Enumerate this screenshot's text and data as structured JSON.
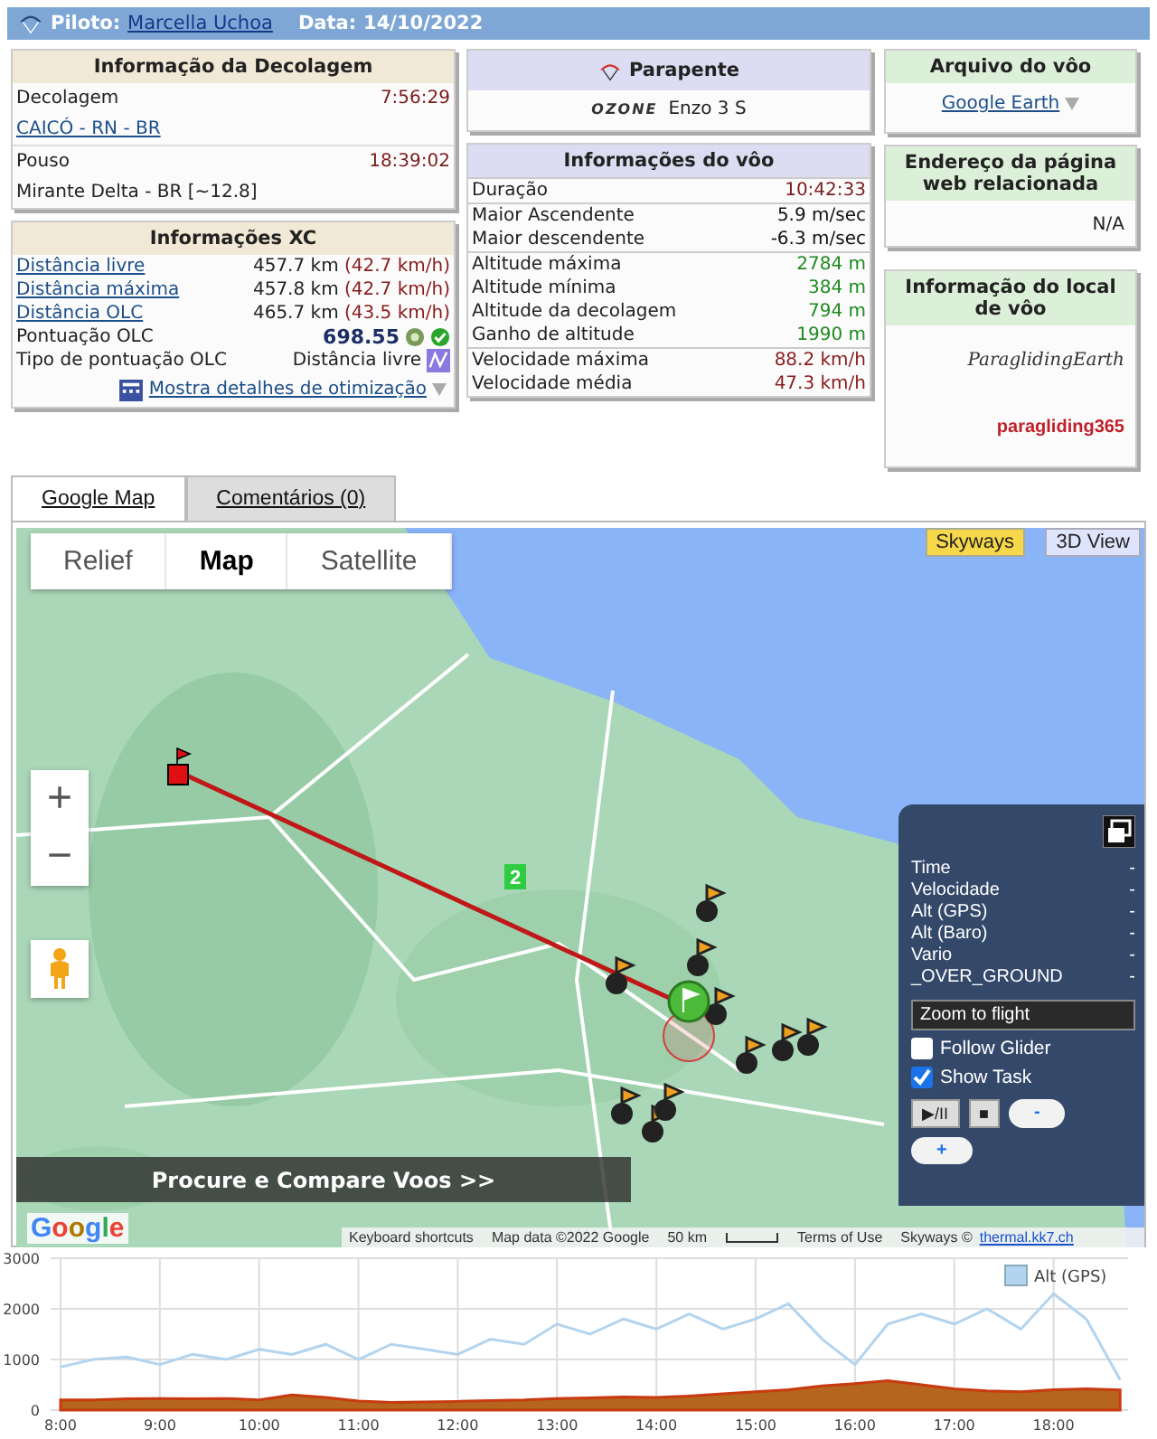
{
  "header": {
    "pilot_label": "Piloto:",
    "pilot_name": "Marcella Uchoa",
    "date_label": "Data:",
    "date": "14/10/2022"
  },
  "takeoff_info": {
    "title": "Informação da Decolagem",
    "takeoff_label": "Decolagem",
    "takeoff_time": "7:56:29",
    "takeoff_site": "CAICÓ - RN - BR",
    "landing_label": "Pouso",
    "landing_time": "18:39:02",
    "landing_site": "Mirante Delta - BR [~12.8]"
  },
  "xc_info": {
    "title": "Informações XC",
    "distances": [
      {
        "label": "Distância livre",
        "value": "457.7 km",
        "speed": "(42.7 km/h)"
      },
      {
        "label": "Distância máxima",
        "value": "457.8 km",
        "speed": "(42.7 km/h)"
      },
      {
        "label": "Distância OLC",
        "value": "465.7 km",
        "speed": "(43.5 km/h)"
      }
    ],
    "score_label": "Pontuação OLC",
    "score": "698.55",
    "type_label": "Tipo de pontuação OLC",
    "type": "Distância livre",
    "details_link": "Mostra detalhes de otimização"
  },
  "glider": {
    "title": "Parapente",
    "brand": "OZONE",
    "model": "Enzo 3 S"
  },
  "flight_info": {
    "title": "Informações do vôo",
    "groups": [
      [
        {
          "label": "Duração",
          "value": "10:42:33",
          "color": "#7a1a1a"
        }
      ],
      [
        {
          "label": "Maior Ascendente",
          "value": "5.9 m/sec",
          "color": "#111111"
        },
        {
          "label": "Maior descendente",
          "value": "-6.3 m/sec",
          "color": "#111111"
        }
      ],
      [
        {
          "label": "Altitude máxima",
          "value": "2784 m",
          "color": "#1f8a1f"
        },
        {
          "label": "Altitude mínima",
          "value": "384 m",
          "color": "#1f8a1f"
        },
        {
          "label": "Altitude da decolagem",
          "value": "794 m",
          "color": "#1f8a1f"
        },
        {
          "label": "Ganho de altitude",
          "value": "1990 m",
          "color": "#1f8a1f"
        }
      ],
      [
        {
          "label": "Velocidade máxima",
          "value": "88.2 km/h",
          "color": "#8b1a1a"
        },
        {
          "label": "Velocidade média",
          "value": "47.3 km/h",
          "color": "#8b1a1a"
        }
      ]
    ]
  },
  "flight_file": {
    "title": "Arquivo do vôo",
    "link": "Google Earth"
  },
  "related_page": {
    "title": "Endereço da página web relacionada",
    "value": "N/A"
  },
  "site_info": {
    "title": "Informação do local de vôo",
    "logos": [
      "ParaglidingEarth",
      "paragliding365"
    ]
  },
  "tabs": [
    {
      "label": "Google Map",
      "selected": true
    },
    {
      "label": "Comentários (0)",
      "selected": false
    }
  ],
  "map": {
    "map_types": [
      {
        "label": "Relief",
        "selected": false
      },
      {
        "label": "Map",
        "selected": true
      },
      {
        "label": "Satellite",
        "selected": false
      }
    ],
    "skyways": "Skyways",
    "view_3d": "3D View",
    "zoom_in": "+",
    "zoom_out": "−",
    "waypoint": "2",
    "panel": {
      "rows": [
        {
          "label": "Time",
          "value": "-"
        },
        {
          "label": "Velocidade",
          "value": "-"
        },
        {
          "label": "Alt (GPS)",
          "value": "-"
        },
        {
          "label": "Alt (Baro)",
          "value": "-"
        },
        {
          "label": "Vario",
          "value": "-"
        },
        {
          "label": "_OVER_GROUND",
          "value": "-"
        }
      ],
      "zoom_button": "Zoom to flight",
      "options": [
        {
          "label": "Follow Glider",
          "checked": false
        },
        {
          "label": "Show Task",
          "checked": true
        }
      ],
      "buttons": [
        "▶/II",
        "■",
        "-",
        "+"
      ]
    },
    "banner": "Procure e Compare Voos >>",
    "google_logo": "Google",
    "shortcuts": "Keyboard shortcuts",
    "map_data": "Map data ©2022 Google",
    "scale": "50 km",
    "terms": "Terms of Use",
    "credit": "Skyways ©",
    "credit_link": "thermal.kk7.ch"
  },
  "altitude_chart": {
    "chart_data": {
      "type": "line",
      "x": [
        8,
        8.33,
        8.67,
        9,
        9.33,
        9.67,
        10,
        10.33,
        10.67,
        11,
        11.33,
        11.67,
        12,
        12.33,
        12.67,
        13,
        13.33,
        13.67,
        14,
        14.33,
        14.67,
        15,
        15.33,
        15.67,
        16,
        16.33,
        16.67,
        17,
        17.33,
        17.67,
        18,
        18.33,
        18.67
      ],
      "xlim": [
        7.9,
        18.75
      ],
      "ylim": [
        0,
        3000
      ],
      "grid": true,
      "xticks": [
        {
          "value": 8,
          "label": "8:00"
        },
        {
          "value": 9,
          "label": "9:00"
        },
        {
          "value": 10,
          "label": "10:00"
        },
        {
          "value": 11,
          "label": "11:00"
        },
        {
          "value": 12,
          "label": "12:00"
        },
        {
          "value": 13,
          "label": "13:00"
        },
        {
          "value": 14,
          "label": "14:00"
        },
        {
          "value": 15,
          "label": "15:00"
        },
        {
          "value": 16,
          "label": "16:00"
        },
        {
          "value": 17,
          "label": "17:00"
        },
        {
          "value": 18,
          "label": "18:00"
        }
      ],
      "yticks": [
        0,
        1000,
        2000,
        3000
      ],
      "series": [
        {
          "name": "Alt (GPS)",
          "color": "#b3d4ee",
          "type": "line",
          "values": [
            850,
            1000,
            1050,
            900,
            1100,
            1000,
            1200,
            1100,
            1300,
            1000,
            1300,
            1200,
            1100,
            1400,
            1300,
            1700,
            1500,
            1800,
            1600,
            1900,
            1600,
            1800,
            2100,
            1400,
            900,
            1700,
            1900,
            1700,
            2000,
            1600,
            2300,
            1800,
            600
          ]
        },
        {
          "color": "#b5651d",
          "type": "area",
          "values": [
            200,
            200,
            220,
            230,
            220,
            230,
            200,
            300,
            250,
            180,
            150,
            160,
            170,
            190,
            200,
            230,
            240,
            260,
            250,
            280,
            320,
            360,
            400,
            480,
            520,
            580,
            500,
            420,
            380,
            360,
            400,
            420,
            400
          ]
        }
      ]
    }
  }
}
